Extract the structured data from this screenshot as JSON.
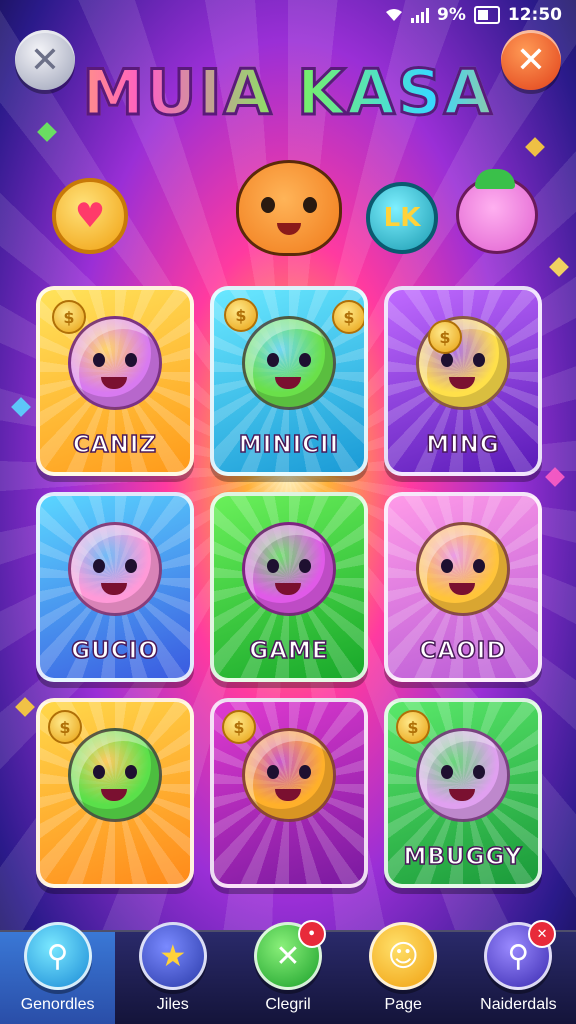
{
  "status_bar": {
    "battery_text": "9%",
    "time": "12:50"
  },
  "header": {
    "title": "MUIA KASA"
  },
  "top_deco": {
    "badge_text": "LK"
  },
  "cards": [
    {
      "label": "CANIZ",
      "theme": "c-yellow",
      "char_color": "#d87af0"
    },
    {
      "label": "MINICII",
      "theme": "c-cyan",
      "char_color": "#6ae04a"
    },
    {
      "label": "MING",
      "theme": "c-purple",
      "char_color": "#ffe04a"
    },
    {
      "label": "GUCIO",
      "theme": "c-blue",
      "char_color": "#ff9ad8"
    },
    {
      "label": "GAME",
      "theme": "c-green",
      "char_color": "#e05ae8"
    },
    {
      "label": "CAOID",
      "theme": "c-pink",
      "char_color": "#ffc43a"
    },
    {
      "label": "",
      "theme": "c-orange",
      "char_color": "#5ae04a"
    },
    {
      "label": "",
      "theme": "c-magenta",
      "char_color": "#ffb02a"
    },
    {
      "label": "MBUGGY",
      "theme": "c-lime",
      "char_color": "#e0a0f0"
    }
  ],
  "nav": [
    {
      "label": "Genordles",
      "icon": "search-icon",
      "glyph": "⚲",
      "badge": ""
    },
    {
      "label": "Jiles",
      "icon": "star-icon",
      "glyph": "★",
      "badge": ""
    },
    {
      "label": "Clegril",
      "icon": "close-icon",
      "glyph": "✕",
      "badge": "•"
    },
    {
      "label": "Page",
      "icon": "face-icon",
      "glyph": "☺",
      "badge": ""
    },
    {
      "label": "Naiderdals",
      "icon": "search-icon",
      "glyph": "⚲",
      "badge": "✕"
    }
  ]
}
